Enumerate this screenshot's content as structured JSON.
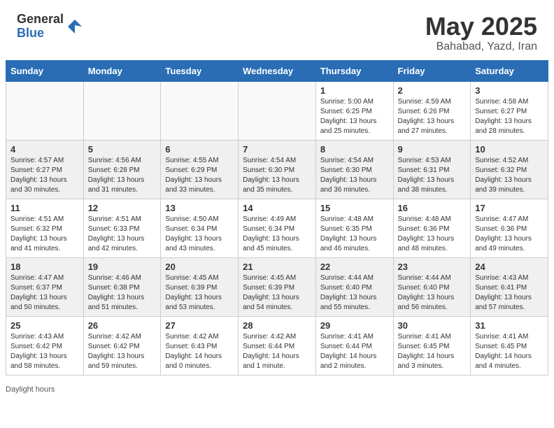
{
  "header": {
    "logo_general": "General",
    "logo_blue": "Blue",
    "month": "May 2025",
    "location": "Bahabad, Yazd, Iran"
  },
  "footer": {
    "daylight_label": "Daylight hours"
  },
  "weekdays": [
    "Sunday",
    "Monday",
    "Tuesday",
    "Wednesday",
    "Thursday",
    "Friday",
    "Saturday"
  ],
  "weeks": [
    [
      {
        "day": "",
        "info": ""
      },
      {
        "day": "",
        "info": ""
      },
      {
        "day": "",
        "info": ""
      },
      {
        "day": "",
        "info": ""
      },
      {
        "day": "1",
        "info": "Sunrise: 5:00 AM\nSunset: 6:25 PM\nDaylight: 13 hours\nand 25 minutes."
      },
      {
        "day": "2",
        "info": "Sunrise: 4:59 AM\nSunset: 6:26 PM\nDaylight: 13 hours\nand 27 minutes."
      },
      {
        "day": "3",
        "info": "Sunrise: 4:58 AM\nSunset: 6:27 PM\nDaylight: 13 hours\nand 28 minutes."
      }
    ],
    [
      {
        "day": "4",
        "info": "Sunrise: 4:57 AM\nSunset: 6:27 PM\nDaylight: 13 hours\nand 30 minutes."
      },
      {
        "day": "5",
        "info": "Sunrise: 4:56 AM\nSunset: 6:28 PM\nDaylight: 13 hours\nand 31 minutes."
      },
      {
        "day": "6",
        "info": "Sunrise: 4:55 AM\nSunset: 6:29 PM\nDaylight: 13 hours\nand 33 minutes."
      },
      {
        "day": "7",
        "info": "Sunrise: 4:54 AM\nSunset: 6:30 PM\nDaylight: 13 hours\nand 35 minutes."
      },
      {
        "day": "8",
        "info": "Sunrise: 4:54 AM\nSunset: 6:30 PM\nDaylight: 13 hours\nand 36 minutes."
      },
      {
        "day": "9",
        "info": "Sunrise: 4:53 AM\nSunset: 6:31 PM\nDaylight: 13 hours\nand 38 minutes."
      },
      {
        "day": "10",
        "info": "Sunrise: 4:52 AM\nSunset: 6:32 PM\nDaylight: 13 hours\nand 39 minutes."
      }
    ],
    [
      {
        "day": "11",
        "info": "Sunrise: 4:51 AM\nSunset: 6:32 PM\nDaylight: 13 hours\nand 41 minutes."
      },
      {
        "day": "12",
        "info": "Sunrise: 4:51 AM\nSunset: 6:33 PM\nDaylight: 13 hours\nand 42 minutes."
      },
      {
        "day": "13",
        "info": "Sunrise: 4:50 AM\nSunset: 6:34 PM\nDaylight: 13 hours\nand 43 minutes."
      },
      {
        "day": "14",
        "info": "Sunrise: 4:49 AM\nSunset: 6:34 PM\nDaylight: 13 hours\nand 45 minutes."
      },
      {
        "day": "15",
        "info": "Sunrise: 4:48 AM\nSunset: 6:35 PM\nDaylight: 13 hours\nand 46 minutes."
      },
      {
        "day": "16",
        "info": "Sunrise: 4:48 AM\nSunset: 6:36 PM\nDaylight: 13 hours\nand 48 minutes."
      },
      {
        "day": "17",
        "info": "Sunrise: 4:47 AM\nSunset: 6:36 PM\nDaylight: 13 hours\nand 49 minutes."
      }
    ],
    [
      {
        "day": "18",
        "info": "Sunrise: 4:47 AM\nSunset: 6:37 PM\nDaylight: 13 hours\nand 50 minutes."
      },
      {
        "day": "19",
        "info": "Sunrise: 4:46 AM\nSunset: 6:38 PM\nDaylight: 13 hours\nand 51 minutes."
      },
      {
        "day": "20",
        "info": "Sunrise: 4:45 AM\nSunset: 6:39 PM\nDaylight: 13 hours\nand 53 minutes."
      },
      {
        "day": "21",
        "info": "Sunrise: 4:45 AM\nSunset: 6:39 PM\nDaylight: 13 hours\nand 54 minutes."
      },
      {
        "day": "22",
        "info": "Sunrise: 4:44 AM\nSunset: 6:40 PM\nDaylight: 13 hours\nand 55 minutes."
      },
      {
        "day": "23",
        "info": "Sunrise: 4:44 AM\nSunset: 6:40 PM\nDaylight: 13 hours\nand 56 minutes."
      },
      {
        "day": "24",
        "info": "Sunrise: 4:43 AM\nSunset: 6:41 PM\nDaylight: 13 hours\nand 57 minutes."
      }
    ],
    [
      {
        "day": "25",
        "info": "Sunrise: 4:43 AM\nSunset: 6:42 PM\nDaylight: 13 hours\nand 58 minutes."
      },
      {
        "day": "26",
        "info": "Sunrise: 4:42 AM\nSunset: 6:42 PM\nDaylight: 13 hours\nand 59 minutes."
      },
      {
        "day": "27",
        "info": "Sunrise: 4:42 AM\nSunset: 6:43 PM\nDaylight: 14 hours\nand 0 minutes."
      },
      {
        "day": "28",
        "info": "Sunrise: 4:42 AM\nSunset: 6:44 PM\nDaylight: 14 hours\nand 1 minute."
      },
      {
        "day": "29",
        "info": "Sunrise: 4:41 AM\nSunset: 6:44 PM\nDaylight: 14 hours\nand 2 minutes."
      },
      {
        "day": "30",
        "info": "Sunrise: 4:41 AM\nSunset: 6:45 PM\nDaylight: 14 hours\nand 3 minutes."
      },
      {
        "day": "31",
        "info": "Sunrise: 4:41 AM\nSunset: 6:45 PM\nDaylight: 14 hours\nand 4 minutes."
      }
    ]
  ]
}
